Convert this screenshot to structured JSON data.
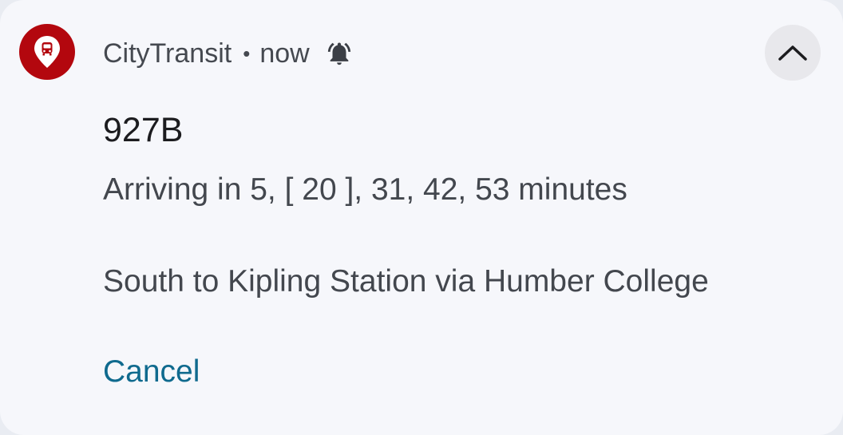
{
  "notification": {
    "app_name": "CityTransit",
    "separator": "•",
    "time": "now",
    "title": "927B",
    "arrivals": "Arriving in 5, [ 20 ], 31, 42, 53 minutes",
    "direction": "South to Kipling Station via Humber College",
    "action_cancel": "Cancel",
    "app_icon": "map-pin-bus-icon",
    "alert_icon": "bell-ringing-icon",
    "expand_icon": "chevron-up-icon"
  },
  "colors": {
    "brand": "#b3070e",
    "accent_link": "#0f6a8e",
    "card_background": "#f6f7fb"
  }
}
